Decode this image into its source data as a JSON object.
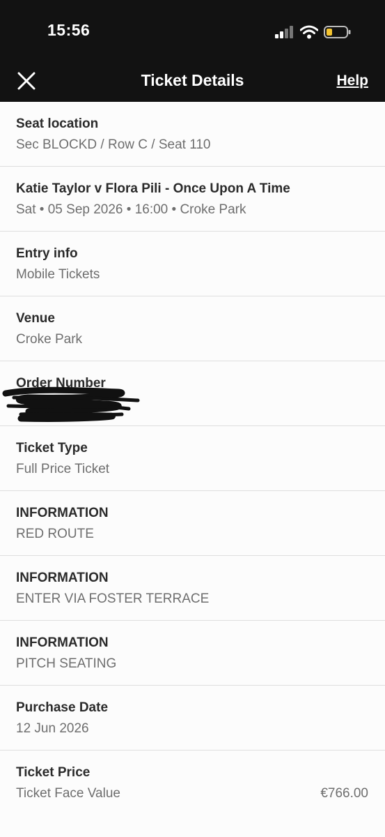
{
  "status_bar": {
    "time": "15:56"
  },
  "nav": {
    "title": "Ticket Details",
    "help_label": "Help"
  },
  "rows": [
    {
      "label": "Seat location",
      "value": "Sec BLOCKD / Row C / Seat 110"
    },
    {
      "label": "Katie Taylor v Flora Pili - Once Upon A Time",
      "value": "Sat • 05 Sep 2026 • 16:00 • Croke Park"
    },
    {
      "label": "Entry info",
      "value": "Mobile Tickets"
    },
    {
      "label": "Venue",
      "value": "Croke Park"
    },
    {
      "label": "Order Number",
      "value": ""
    },
    {
      "label": "Ticket Type",
      "value": "Full Price Ticket"
    },
    {
      "label": "INFORMATION",
      "value": "RED ROUTE"
    },
    {
      "label": "INFORMATION",
      "value": "ENTER VIA FOSTER TERRACE"
    },
    {
      "label": "INFORMATION",
      "value": "PITCH SEATING"
    },
    {
      "label": "Purchase Date",
      "value": "12 Jun 2026"
    },
    {
      "label": "Ticket Price",
      "value": "Ticket Face Value",
      "amount": "€766.00"
    }
  ]
}
